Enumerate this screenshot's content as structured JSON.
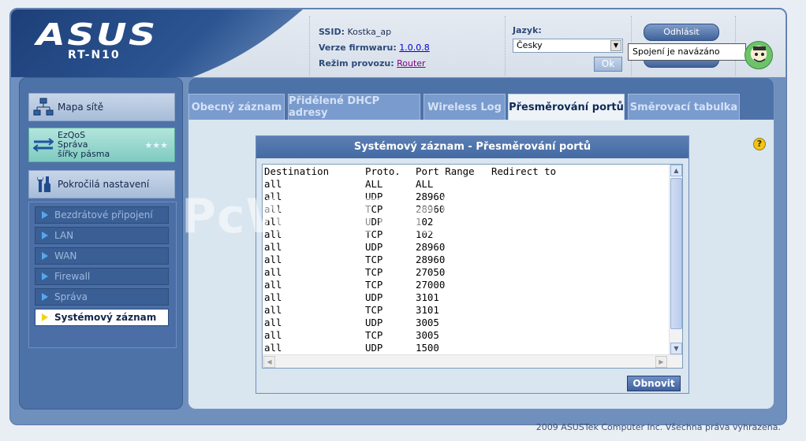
{
  "header": {
    "logo": "ASUS",
    "model": "RT-N10",
    "ssid_label": "SSID:",
    "ssid_value": "Kostka_ap",
    "firmware_label": "Verze firmwaru:",
    "firmware_value": "1.0.0.8",
    "mode_label": "Režim provozu:",
    "mode_value": "Router",
    "language_label": "Jazyk:",
    "language_value": "Česky",
    "ok_label": "Ok",
    "logout_label": "Odhlásit",
    "status_tooltip": "Spojení je navázáno"
  },
  "sidebar": {
    "main_items": [
      {
        "label": "Mapa sítě",
        "icon": "network-map-icon"
      },
      {
        "label_lines": [
          "EzQoS",
          "Správa",
          "šířky pásma"
        ],
        "icon": "bandwidth-icon"
      },
      {
        "label": "Pokročilá nastavení",
        "icon": "wrench-icon"
      }
    ],
    "sub_items": [
      {
        "label": "Bezdrátové připojení"
      },
      {
        "label": "LAN"
      },
      {
        "label": "WAN"
      },
      {
        "label": "Firewall"
      },
      {
        "label": "Správa"
      },
      {
        "label": "Systémový záznam",
        "active": true
      }
    ]
  },
  "tabs": [
    {
      "label": "Obecný záznam"
    },
    {
      "label": "Přidělené DHCP adresy"
    },
    {
      "label": "Wireless Log"
    },
    {
      "label": "Přesměrování portů",
      "active": true
    },
    {
      "label": "Směrovací tabulka"
    }
  ],
  "panel": {
    "title": "Systémový záznam - Přesměrování portů",
    "log_header": {
      "destination": "Destination",
      "proto": "Proto.",
      "port_range": "Port Range",
      "redirect": "Redirect to"
    },
    "log_rows": [
      {
        "destination": "all",
        "proto": "ALL",
        "port_range": "ALL",
        "redirect": ""
      },
      {
        "destination": "all",
        "proto": "UDP",
        "port_range": "28960",
        "redirect": ""
      },
      {
        "destination": "all",
        "proto": "TCP",
        "port_range": "28960",
        "redirect": ""
      },
      {
        "destination": "all",
        "proto": "UDP",
        "port_range": "102",
        "redirect": ""
      },
      {
        "destination": "all",
        "proto": "TCP",
        "port_range": "102",
        "redirect": ""
      },
      {
        "destination": "all",
        "proto": "UDP",
        "port_range": "28960",
        "redirect": ""
      },
      {
        "destination": "all",
        "proto": "TCP",
        "port_range": "28960",
        "redirect": ""
      },
      {
        "destination": "all",
        "proto": "TCP",
        "port_range": "27050",
        "redirect": ""
      },
      {
        "destination": "all",
        "proto": "TCP",
        "port_range": "27000",
        "redirect": ""
      },
      {
        "destination": "all",
        "proto": "UDP",
        "port_range": "3101",
        "redirect": ""
      },
      {
        "destination": "all",
        "proto": "TCP",
        "port_range": "3101",
        "redirect": ""
      },
      {
        "destination": "all",
        "proto": "UDP",
        "port_range": "3005",
        "redirect": ""
      },
      {
        "destination": "all",
        "proto": "TCP",
        "port_range": "3005",
        "redirect": ""
      },
      {
        "destination": "all",
        "proto": "UDP",
        "port_range": "1500",
        "redirect": ""
      }
    ],
    "refresh_label": "Obnovit"
  },
  "watermark": "PcWinTech.com",
  "footer": "2009 ASUSTek Computer Inc. Všechna práva vyhrazena.",
  "colors": {
    "frame": "#6f8fbd",
    "sidebar": "#4d72a8",
    "active_tab": "#eef3f8",
    "accent_yellow": "#f2d21a"
  }
}
